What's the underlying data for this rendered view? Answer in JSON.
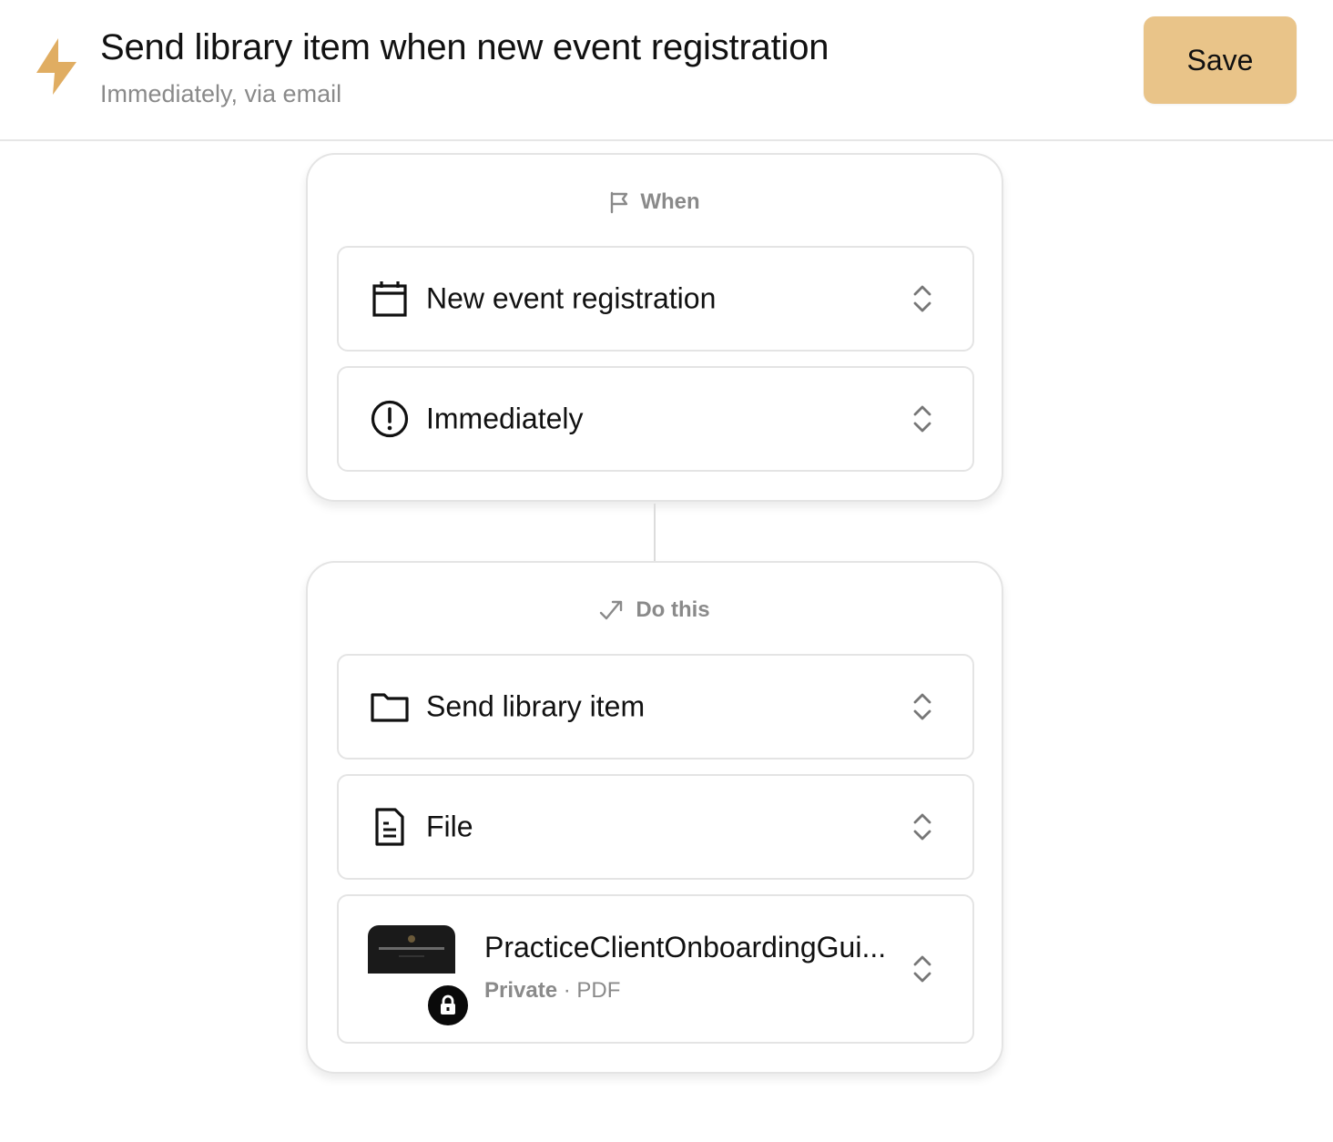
{
  "header": {
    "icon": "lightning-bolt-icon",
    "title": "Send library item when new event registration",
    "subtitle": "Immediately, via email",
    "save_label": "Save"
  },
  "colors": {
    "accent": "#e9c489",
    "bolt": "#e0ad62",
    "muted_text": "#8a8a8a",
    "border": "#e4e4e4"
  },
  "when_card": {
    "heading_icon": "flag-icon",
    "heading": "When",
    "trigger": {
      "icon": "calendar-icon",
      "label": "New event registration"
    },
    "timing": {
      "icon": "alert-circle-icon",
      "label": "Immediately"
    }
  },
  "do_card": {
    "heading_icon": "route-arrow-icon",
    "heading": "Do this",
    "action": {
      "icon": "folder-icon",
      "label": "Send library item"
    },
    "item_type": {
      "icon": "document-icon",
      "label": "File"
    },
    "file": {
      "name": "PracticeClientOnboardingGui...",
      "visibility": "Private",
      "separator": "·",
      "format": "PDF"
    }
  }
}
